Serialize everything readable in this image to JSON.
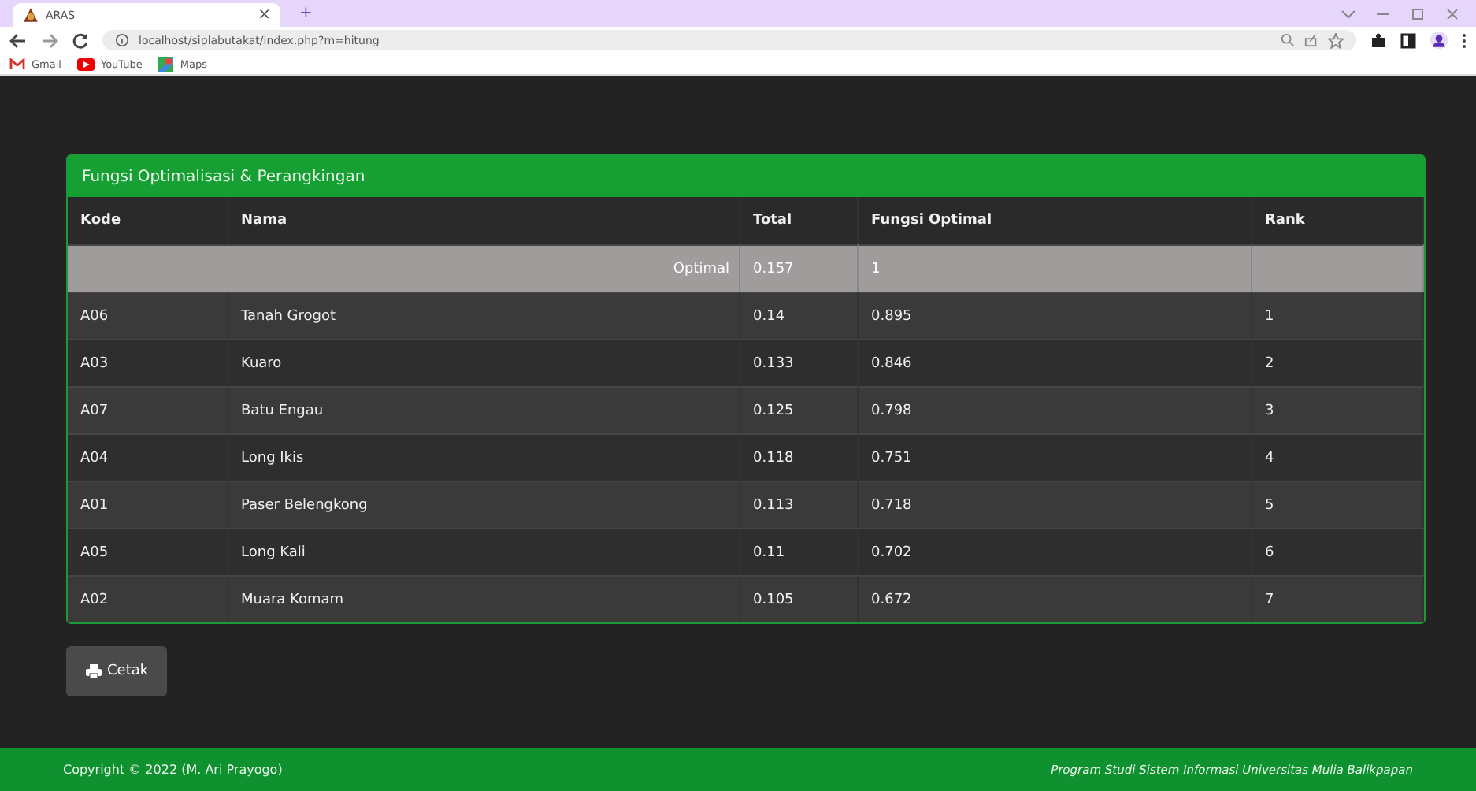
{
  "browser": {
    "tab_title": "ARAS",
    "tab_close": "×",
    "new_tab": "+",
    "url": "localhost/siplabutakat/index.php?m=hitung",
    "bookmarks": [
      {
        "label": "Gmail",
        "kind": "gmail"
      },
      {
        "label": "YouTube",
        "kind": "youtube"
      },
      {
        "label": "Maps",
        "kind": "maps"
      }
    ]
  },
  "panel": {
    "title": "Fungsi Optimalisasi & Perangkingan",
    "columns": [
      "Kode",
      "Nama",
      "Total",
      "Fungsi Optimal",
      "Rank"
    ],
    "optimal_row": {
      "label": "Optimal",
      "total": "0.157",
      "fungsi_optimal": "1"
    },
    "rows": [
      {
        "kode": "A06",
        "nama": "Tanah Grogot",
        "total": "0.14",
        "fungsi_optimal": "0.895",
        "rank": "1"
      },
      {
        "kode": "A03",
        "nama": "Kuaro",
        "total": "0.133",
        "fungsi_optimal": "0.846",
        "rank": "2"
      },
      {
        "kode": "A07",
        "nama": "Batu Engau",
        "total": "0.125",
        "fungsi_optimal": "0.798",
        "rank": "3"
      },
      {
        "kode": "A04",
        "nama": "Long Ikis",
        "total": "0.118",
        "fungsi_optimal": "0.751",
        "rank": "4"
      },
      {
        "kode": "A01",
        "nama": "Paser Belengkong",
        "total": "0.113",
        "fungsi_optimal": "0.718",
        "rank": "5"
      },
      {
        "kode": "A05",
        "nama": "Long Kali",
        "total": "0.11",
        "fungsi_optimal": "0.702",
        "rank": "6"
      },
      {
        "kode": "A02",
        "nama": "Muara Komam",
        "total": "0.105",
        "fungsi_optimal": "0.672",
        "rank": "7"
      }
    ]
  },
  "print_button": "Cetak",
  "footer": {
    "copyright": "Copyright © 2022 (M. Ari Prayogo)",
    "program": "Program Studi Sistem Informasi Universitas Mulia Balikpapan"
  }
}
